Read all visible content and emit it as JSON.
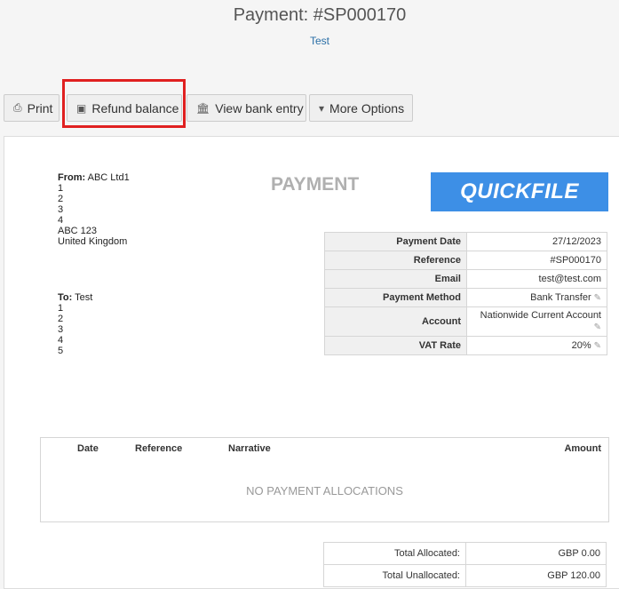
{
  "header": {
    "title": "Payment: #SP000170",
    "subtitle": "Test"
  },
  "toolbar": {
    "print": "Print",
    "refund": "Refund balance",
    "bank": "View bank entry",
    "more": "More Options"
  },
  "document": {
    "title": "PAYMENT",
    "logo": "QUICKFILE",
    "from_label": "From:",
    "from_name": "ABC Ltd1",
    "from_lines": [
      "1",
      "2",
      "3",
      "4",
      "ABC 123",
      "United Kingdom"
    ],
    "to_label": "To:",
    "to_name": "Test",
    "to_lines": [
      "1",
      "2",
      "3",
      "4",
      "5"
    ]
  },
  "details": [
    {
      "label": "Payment Date",
      "value": "27/12/2023"
    },
    {
      "label": "Reference",
      "value": "#SP000170"
    },
    {
      "label": "Email",
      "value": "test@test.com"
    },
    {
      "label": "Payment Method",
      "value": "Bank Transfer"
    },
    {
      "label": "Account",
      "value": "Nationwide Current Account"
    },
    {
      "label": "VAT Rate",
      "value": "20%"
    }
  ],
  "allocations": {
    "columns": [
      "Date",
      "Reference",
      "Narrative",
      "Amount"
    ],
    "empty": "NO PAYMENT ALLOCATIONS"
  },
  "totals": [
    {
      "label": "Total Allocated:",
      "value": "GBP 0.00"
    },
    {
      "label": "Total Unallocated:",
      "value": "GBP 120.00"
    }
  ],
  "colors": {
    "highlight": "#e02020",
    "logo_bg": "#3d8fe6",
    "link": "#2a6ea6"
  },
  "icons": {
    "print": "printer-icon",
    "refund": "refund-icon",
    "bank": "bank-icon",
    "more": "caret-down-icon",
    "edit": "pencil-icon"
  }
}
